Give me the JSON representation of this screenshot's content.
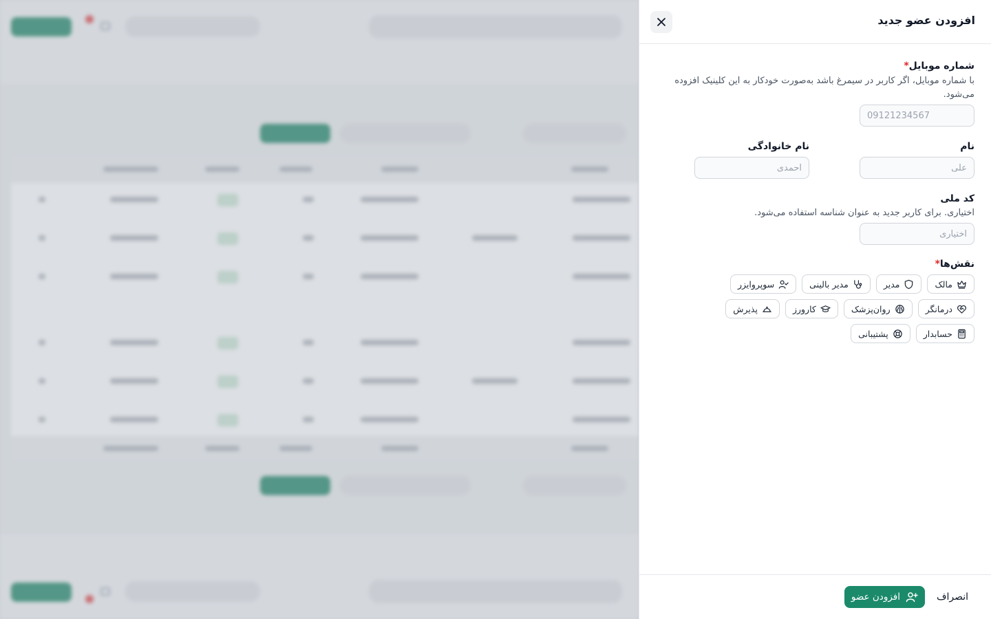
{
  "drawer": {
    "title": "افزودن عضو جدید",
    "close_icon": "close-icon"
  },
  "form": {
    "mobile": {
      "label": "شماره موبایل",
      "required_mark": "*",
      "help": "با شماره موبایل، اگر کاربر در سیمرغ باشد به‌صورت خودکار به این کلینیک افزوده می‌شود.",
      "placeholder": "09121234567",
      "value": ""
    },
    "first_name": {
      "label": "نام",
      "placeholder": "علی",
      "value": ""
    },
    "last_name": {
      "label": "نام خانوادگی",
      "placeholder": "احمدی",
      "value": ""
    },
    "national_code": {
      "label": "کد ملی",
      "help": "اختیاری. برای کاربر جدید به عنوان شناسه استفاده می‌شود.",
      "placeholder": "اختیاری",
      "value": ""
    },
    "roles": {
      "label": "نقش‌ها",
      "required_mark": "*",
      "items": [
        {
          "label": "مالک",
          "icon": "crown-icon"
        },
        {
          "label": "مدیر",
          "icon": "shield-icon"
        },
        {
          "label": "مدیر بالینی",
          "icon": "stethoscope-icon"
        },
        {
          "label": "سوپروایزر",
          "icon": "user-check-icon"
        },
        {
          "label": "درمانگر",
          "icon": "heart-handshake-icon"
        },
        {
          "label": "روان‌پزشک",
          "icon": "brain-icon"
        },
        {
          "label": "کارورز",
          "icon": "graduation-cap-icon"
        },
        {
          "label": "پذیرش",
          "icon": "concierge-bell-icon"
        },
        {
          "label": "حسابدار",
          "icon": "calculator-icon"
        },
        {
          "label": "پشتیبانی",
          "icon": "life-buoy-icon"
        }
      ]
    }
  },
  "footer": {
    "cancel_label": "انصراف",
    "submit_label": "افزودن عضو",
    "submit_icon": "user-plus-icon"
  },
  "colors": {
    "primary": "#1b8a6b",
    "required": "#dc2626"
  }
}
